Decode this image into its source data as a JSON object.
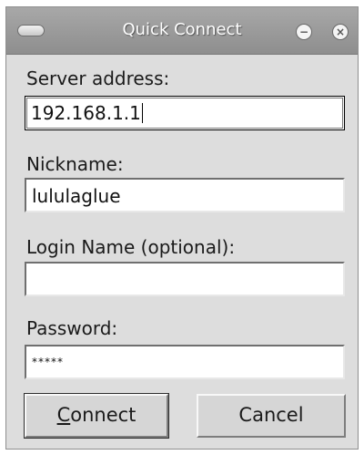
{
  "window": {
    "title": "Quick Connect",
    "minimize_glyph": "−",
    "close_glyph": "×"
  },
  "form": {
    "server": {
      "label": "Server address:",
      "value": "192.168.1.1"
    },
    "nickname": {
      "label": "Nickname:",
      "value": "lululaglue"
    },
    "login": {
      "label": "Login Name (optional):",
      "value": ""
    },
    "password": {
      "label": "Password:",
      "value": "*****"
    }
  },
  "buttons": {
    "connect_mnemonic": "C",
    "connect_rest": "onnect",
    "cancel": "Cancel"
  },
  "colors": {
    "window_bg": "#dddddd",
    "titlebar": "#9a9a9a",
    "title_text": "#ffffff"
  }
}
